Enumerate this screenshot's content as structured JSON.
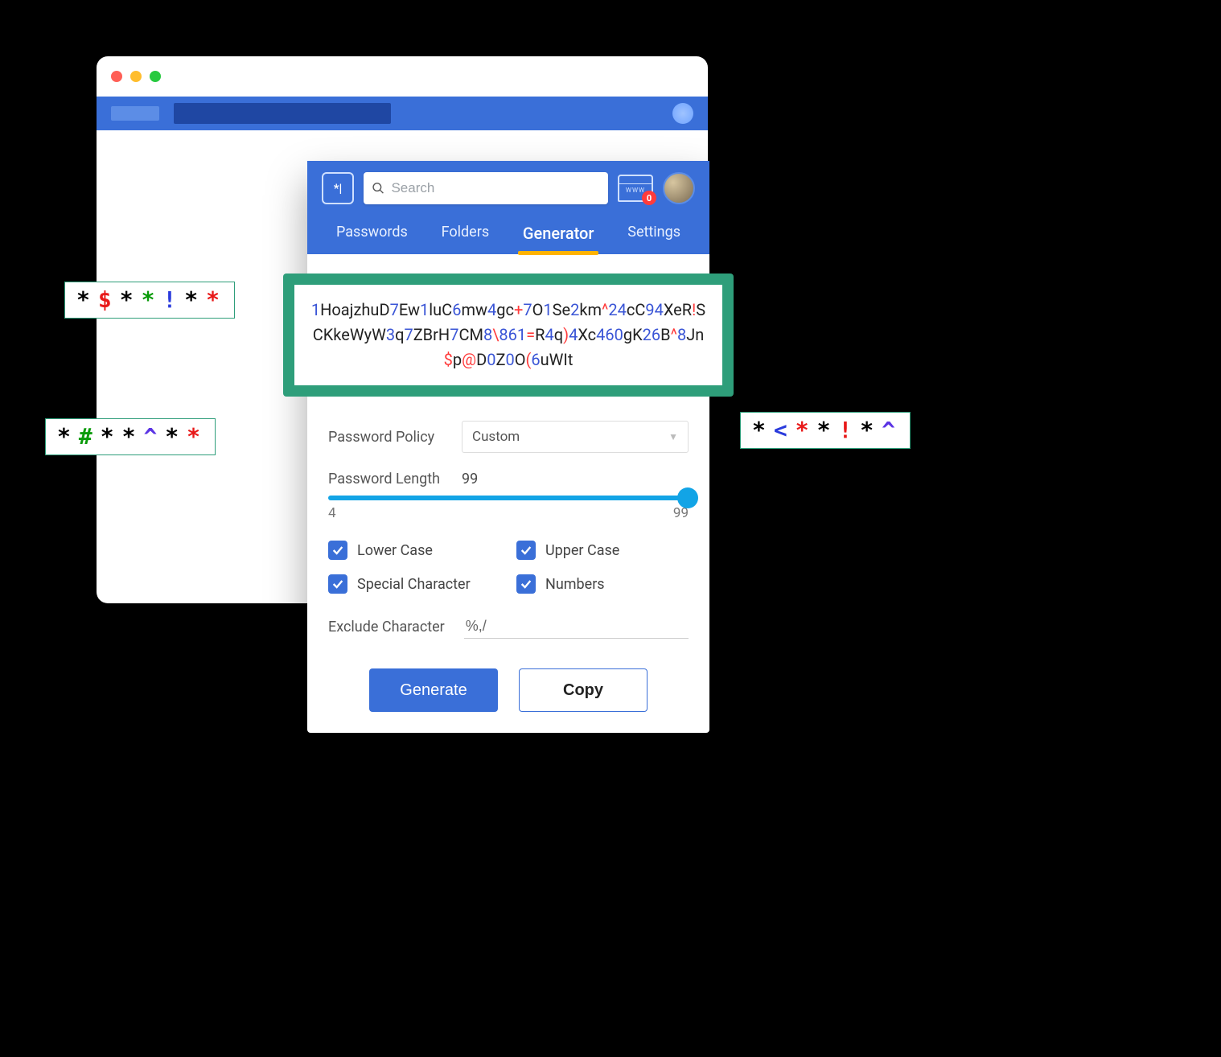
{
  "search": {
    "placeholder": "Search"
  },
  "www_badge": "0",
  "tabs": [
    {
      "label": "Passwords",
      "active": false
    },
    {
      "label": "Folders",
      "active": false
    },
    {
      "label": "Generator",
      "active": true
    },
    {
      "label": "Settings",
      "active": false
    }
  ],
  "generated_password": "1HoajzhuD7Ew1luC6mw4gc+7O1Se2km^24cC94XeR!SCKkeWyW3q7ZBrH7CM8\\861=R4q)4Xc460gK26B^8Jn$p@D0Z0O(6uWIt",
  "form": {
    "policy_label": "Password Policy",
    "policy_value": "Custom",
    "length_label": "Password Length",
    "length_value": "99",
    "length_min": "4",
    "length_max": "99",
    "checks": {
      "lower": "Lower Case",
      "upper": "Upper Case",
      "special": "Special Character",
      "numbers": "Numbers"
    },
    "exclude_label": "Exclude Character",
    "exclude_value": "%,/"
  },
  "buttons": {
    "generate": "Generate",
    "copy": "Copy"
  },
  "chips": {
    "c1": [
      {
        "t": "*",
        "c": "black"
      },
      {
        "t": "$",
        "c": "red"
      },
      {
        "t": "*",
        "c": "black"
      },
      {
        "t": "*",
        "c": "green"
      },
      {
        "t": "!",
        "c": "blue"
      },
      {
        "t": "*",
        "c": "black"
      },
      {
        "t": "*",
        "c": "red"
      }
    ],
    "c2": [
      {
        "t": "*",
        "c": "black"
      },
      {
        "t": "#",
        "c": "green"
      },
      {
        "t": "*",
        "c": "black"
      },
      {
        "t": "*",
        "c": "black"
      },
      {
        "t": "^",
        "c": "blue2"
      },
      {
        "t": "*",
        "c": "black"
      },
      {
        "t": "*",
        "c": "red"
      }
    ],
    "c3": [
      {
        "t": "*",
        "c": "black"
      },
      {
        "t": "<",
        "c": "blue"
      },
      {
        "t": "*",
        "c": "red"
      },
      {
        "t": "*",
        "c": "black"
      },
      {
        "t": "!",
        "c": "red"
      },
      {
        "t": "*",
        "c": "black"
      },
      {
        "t": "^",
        "c": "blue2"
      }
    ]
  }
}
